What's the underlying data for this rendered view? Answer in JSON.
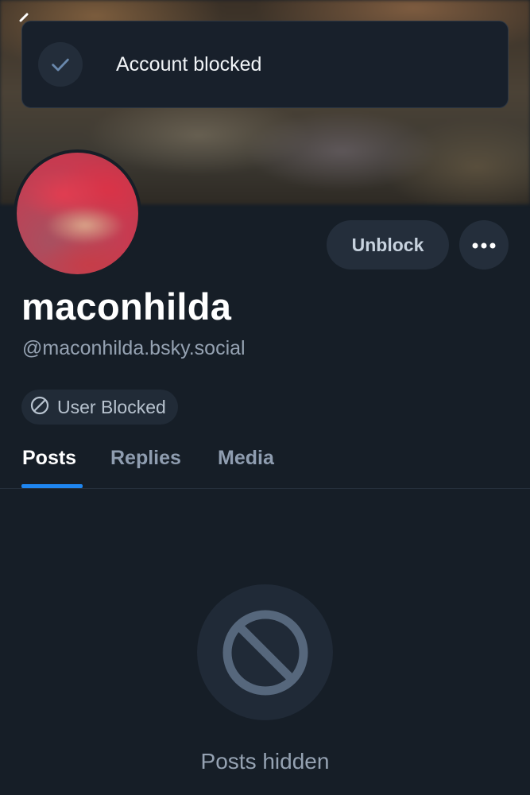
{
  "toast": {
    "message": "Account blocked",
    "icon": "checkmark-icon"
  },
  "profile": {
    "display_name": "maconhilda",
    "handle": "@maconhilda.bsky.social",
    "badge": "User Blocked"
  },
  "actions": {
    "unblock_label": "Unblock",
    "more_icon": "more-icon"
  },
  "tabs": [
    {
      "label": "Posts",
      "active": true
    },
    {
      "label": "Replies",
      "active": false
    },
    {
      "label": "Media",
      "active": false
    }
  ],
  "empty_state": {
    "message": "Posts hidden",
    "icon": "block-icon"
  },
  "colors": {
    "accent": "#1f86f0",
    "background": "#161e27"
  }
}
